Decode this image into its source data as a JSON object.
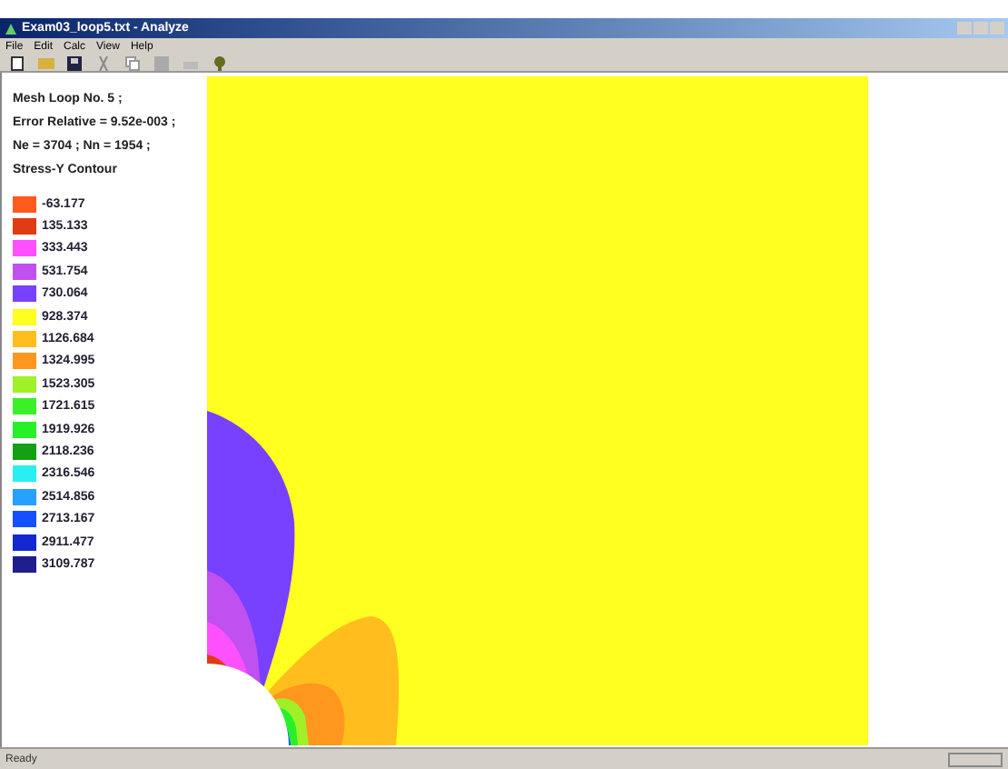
{
  "window": {
    "title": "Exam03_loop5.txt - Analyze"
  },
  "menu": [
    "File",
    "Edit",
    "Calc",
    "View",
    "Help"
  ],
  "info": [
    "Mesh Loop No. 5 ;",
    "Error Relative = 9.52e-003 ;",
    "Ne = 3704 ; Nn = 1954 ;",
    "Stress-Y Contour"
  ],
  "legend": [
    {
      "value": "-63.177",
      "color": "#ff5a1e"
    },
    {
      "value": "135.133",
      "color": "#e03c14"
    },
    {
      "value": "333.443",
      "color": "#ff50ff"
    },
    {
      "value": "531.754",
      "color": "#c050f0"
    },
    {
      "value": "730.064",
      "color": "#7840ff"
    },
    {
      "value": "928.374",
      "color": "#ffff20"
    },
    {
      "value": "1126.684",
      "color": "#ffbe1e"
    },
    {
      "value": "1324.995",
      "color": "#ff961e"
    },
    {
      "value": "1523.305",
      "color": "#a0f028"
    },
    {
      "value": "1721.615",
      "color": "#3cf028"
    },
    {
      "value": "1919.926",
      "color": "#28f028"
    },
    {
      "value": "2118.236",
      "color": "#14a014"
    },
    {
      "value": "2316.546",
      "color": "#28f0f0"
    },
    {
      "value": "2514.856",
      "color": "#28a0ff"
    },
    {
      "value": "2713.167",
      "color": "#1450ff"
    },
    {
      "value": "2911.477",
      "color": "#1428d2"
    },
    {
      "value": "3109.787",
      "color": "#1e1e8c"
    }
  ],
  "status_bar": {
    "text": "Ready"
  }
}
